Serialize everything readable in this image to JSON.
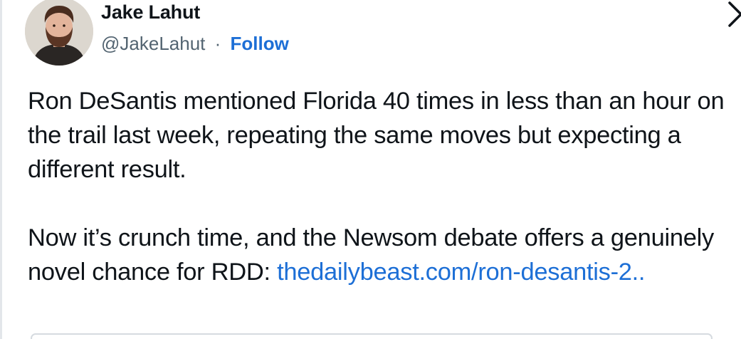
{
  "author": {
    "name": "Jake Lahut",
    "handle": "@JakeLahut",
    "separator": "·",
    "follow_label": "Follow"
  },
  "tweet": {
    "paragraph1": "Ron DeSantis mentioned Florida 40 times in less than an hour on the trail last week, repeating the same moves but expecting a different result.",
    "paragraph2_text": "Now it’s crunch time, and the Newsom debate offers a genuinely novel chance for RDD: ",
    "link_text": "thedailybeast.com/ron-desantis-2.."
  },
  "icons": {
    "avatar": "profile-photo",
    "chevron": "chevron-right-icon"
  },
  "colors": {
    "text": "#0f1419",
    "secondary": "#536471",
    "link": "#1d6fd6"
  }
}
